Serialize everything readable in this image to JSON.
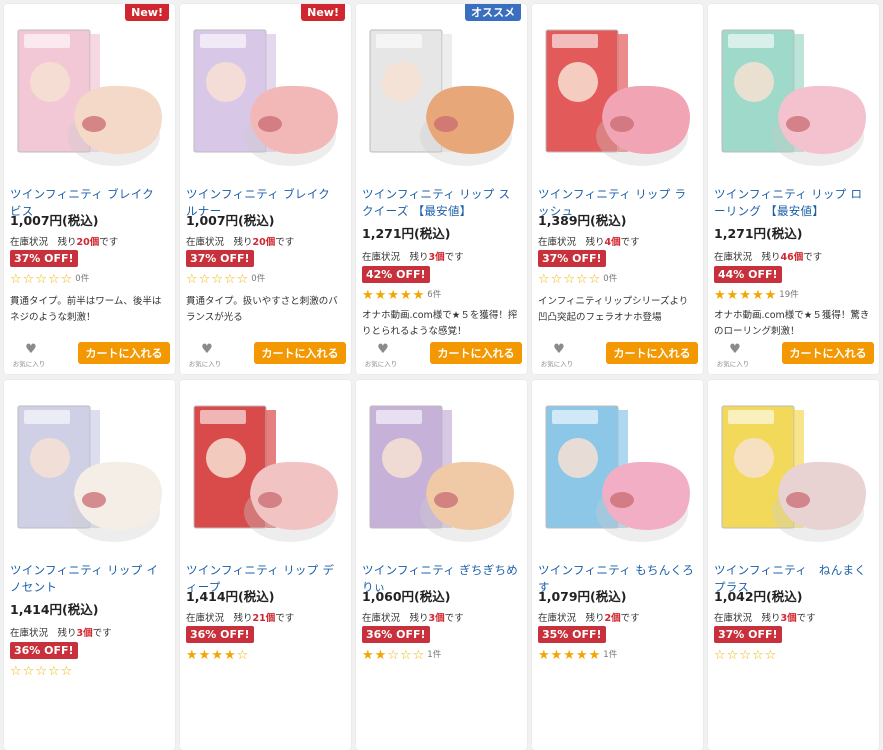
{
  "products": [
    {
      "badge": "New!",
      "badge_color": "#d0262f",
      "name": "ツインフィニティ ブレイク ビス",
      "price": "1,007円(税込)",
      "stock_label": "在庫状況　残り",
      "stock_count": "20個",
      "stock_suffix": "です",
      "discount": "37% OFF!",
      "rating": 0,
      "reviews": "0件",
      "desc": "貫通タイプ。前半はワーム、後半はネジのような刺激！",
      "fav_label": "お気に入り",
      "cart_label": "カートに入れる",
      "box_color": "#f2c7d6",
      "toy_color": "#f4d8c8"
    },
    {
      "badge": "New!",
      "badge_color": "#d0262f",
      "name": "ツインフィニティ ブレイク ルナー",
      "price": "1,007円(税込)",
      "stock_label": "在庫状況　残り",
      "stock_count": "20個",
      "stock_suffix": "です",
      "discount": "37% OFF!",
      "rating": 0,
      "reviews": "0件",
      "desc": "貫通タイプ。扱いやすさと刺激のバランスが光る",
      "fav_label": "お気に入り",
      "cart_label": "カートに入れる",
      "box_color": "#d9c7e8",
      "toy_color": "#f2b7b7"
    },
    {
      "badge": "オススメ",
      "badge_color": "#3a6fbf",
      "name": "ツインフィニティ リップ スクイーズ 【最安値】",
      "price": "1,271円(税込)",
      "stock_label": "在庫状況　残り",
      "stock_count": "3個",
      "stock_suffix": "です",
      "discount": "42% OFF!",
      "rating": 4.5,
      "reviews": "6件",
      "desc": "オナホ動画.com様で★５を獲得！搾りとられるような感覚！",
      "fav_label": "お気に入り",
      "cart_label": "カートに入れる",
      "box_color": "#e6e6e6",
      "toy_color": "#e8a779"
    },
    {
      "badge": "",
      "badge_color": "",
      "name": "ツインフィニティ リップ ラッシュ",
      "price": "1,389円(税込)",
      "stock_label": "在庫状況　残り",
      "stock_count": "4個",
      "stock_suffix": "です",
      "discount": "37% OFF!",
      "rating": 0,
      "reviews": "0件",
      "desc": "インフィニティリップシリーズより凹凸突起のフェラオナホ登場",
      "fav_label": "お気に入り",
      "cart_label": "カートに入れる",
      "box_color": "#e35a5a",
      "toy_color": "#f0a4b4"
    },
    {
      "badge": "",
      "badge_color": "",
      "name": "ツインフィニティ リップ ローリング 【最安値】",
      "price": "1,271円(税込)",
      "stock_label": "在庫状況　残り",
      "stock_count": "46個",
      "stock_suffix": "です",
      "discount": "44% OFF!",
      "rating": 4.5,
      "reviews": "19件",
      "desc": "オナホ動画.com様で★５獲得！驚きのローリング刺激！",
      "fav_label": "お気に入り",
      "cart_label": "カートに入れる",
      "box_color": "#9fd9c9",
      "toy_color": "#f4c2cf"
    },
    {
      "badge": "",
      "badge_color": "",
      "name": "ツインフィニティ リップ イノセント",
      "price": "1,414円(税込)",
      "stock_label": "在庫状況　残り",
      "stock_count": "3個",
      "stock_suffix": "です",
      "discount": "36% OFF!",
      "rating": 0,
      "reviews": "",
      "desc": "",
      "fav_label": "",
      "cart_label": "",
      "box_color": "#cfd0e6",
      "toy_color": "#f5eee6"
    },
    {
      "badge": "",
      "badge_color": "",
      "name": "ツインフィニティ リップ ディープ",
      "price": "1,414円(税込)",
      "stock_label": "在庫状況　残り",
      "stock_count": "21個",
      "stock_suffix": "です",
      "discount": "36% OFF!",
      "rating": 4,
      "reviews": "",
      "desc": "",
      "fav_label": "",
      "cart_label": "",
      "box_color": "#d94a4a",
      "toy_color": "#f2c3c3"
    },
    {
      "badge": "",
      "badge_color": "",
      "name": "ツインフィニティ ぎちぎちめりぃ",
      "price": "1,060円(税込)",
      "stock_label": "在庫状況　残り",
      "stock_count": "3個",
      "stock_suffix": "です",
      "discount": "36% OFF!",
      "rating": 2,
      "reviews": "1件",
      "desc": "",
      "fav_label": "",
      "cart_label": "",
      "box_color": "#c6b2d9",
      "toy_color": "#f0c9a6"
    },
    {
      "badge": "",
      "badge_color": "",
      "name": "ツインフィニティ もちんくろす",
      "price": "1,079円(税込)",
      "stock_label": "在庫状況　残り",
      "stock_count": "2個",
      "stock_suffix": "です",
      "discount": "35% OFF!",
      "rating": 5,
      "reviews": "1件",
      "desc": "",
      "fav_label": "",
      "cart_label": "",
      "box_color": "#8cc7e8",
      "toy_color": "#f2aec4"
    },
    {
      "badge": "",
      "badge_color": "",
      "name": "ツインフィニティ　ねんまくプラス",
      "price": "1,042円(税込)",
      "stock_label": "在庫状況　残り",
      "stock_count": "3個",
      "stock_suffix": "です",
      "discount": "37% OFF!",
      "rating": 0,
      "reviews": "",
      "desc": "",
      "fav_label": "",
      "cart_label": "",
      "box_color": "#f3d95a",
      "toy_color": "#e9d2d2"
    }
  ]
}
